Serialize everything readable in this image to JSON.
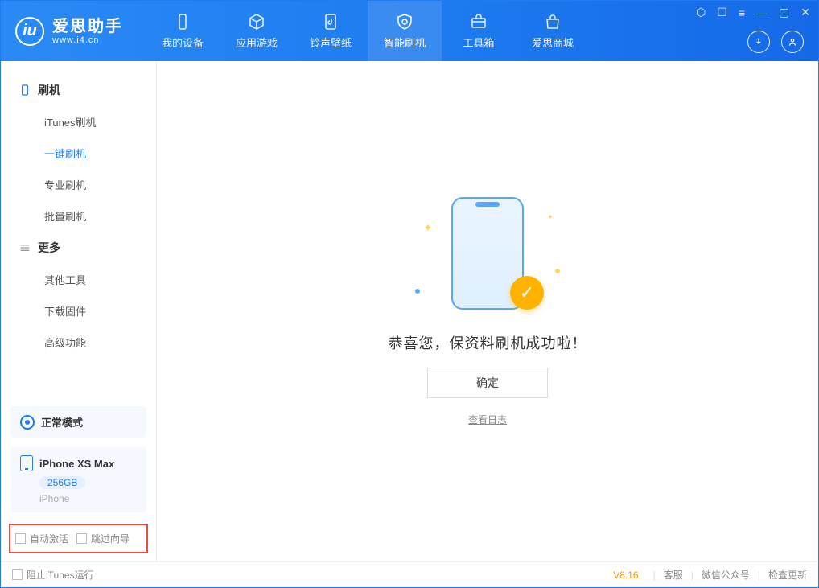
{
  "app": {
    "name": "爱思助手",
    "domain": "www.i4.cn"
  },
  "window_controls": {
    "shirt": "⬡",
    "menu": "☰",
    "min": "—",
    "max": "▢",
    "close": "✕",
    "extra": "≡"
  },
  "tabs": [
    {
      "label": "我的设备"
    },
    {
      "label": "应用游戏"
    },
    {
      "label": "铃声壁纸"
    },
    {
      "label": "智能刷机",
      "active": true
    },
    {
      "label": "工具箱"
    },
    {
      "label": "爱思商城"
    }
  ],
  "header_icons": {
    "download": "↓",
    "user": "◯"
  },
  "sidebar": {
    "sections": [
      {
        "title": "刷机",
        "icon": "device",
        "items": [
          {
            "label": "iTunes刷机"
          },
          {
            "label": "一键刷机",
            "active": true
          },
          {
            "label": "专业刷机"
          },
          {
            "label": "批量刷机"
          }
        ]
      },
      {
        "title": "更多",
        "icon": "menu",
        "items": [
          {
            "label": "其他工具"
          },
          {
            "label": "下载固件"
          },
          {
            "label": "高级功能"
          }
        ]
      }
    ],
    "mode": "正常模式",
    "device": {
      "name": "iPhone XS Max",
      "storage": "256GB",
      "type": "iPhone"
    },
    "options": {
      "auto_activate": "自动激活",
      "skip_guide": "跳过向导"
    }
  },
  "main": {
    "message": "恭喜您，保资料刷机成功啦！",
    "ok": "确定",
    "view_log": "查看日志"
  },
  "footer": {
    "block_itunes": "阻止iTunes运行",
    "version": "V8.16",
    "links": [
      "客服",
      "微信公众号",
      "检查更新"
    ]
  }
}
